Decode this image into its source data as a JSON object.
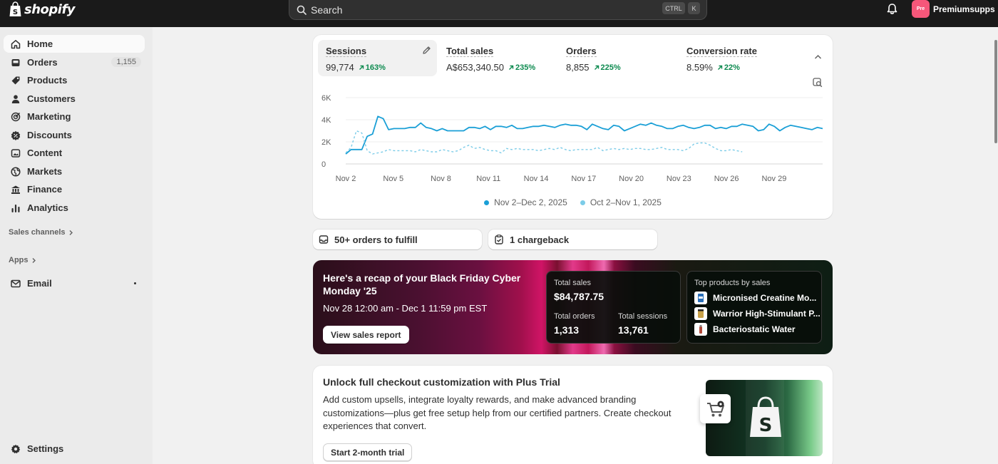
{
  "topbar": {
    "brand": "shopify",
    "search_placeholder": "Search",
    "shortcut_ctrl": "CTRL",
    "shortcut_k": "K",
    "store_initials": "Pre",
    "store_name": "Premiumsupps"
  },
  "sidebar": {
    "items": [
      {
        "label": "Home",
        "icon": "home-icon"
      },
      {
        "label": "Orders",
        "icon": "orders-icon",
        "badge": "1,155"
      },
      {
        "label": "Products",
        "icon": "tag-icon"
      },
      {
        "label": "Customers",
        "icon": "person-icon"
      },
      {
        "label": "Marketing",
        "icon": "target-icon"
      },
      {
        "label": "Discounts",
        "icon": "discount-icon"
      },
      {
        "label": "Content",
        "icon": "content-icon"
      },
      {
        "label": "Markets",
        "icon": "globe-icon"
      },
      {
        "label": "Finance",
        "icon": "bank-icon"
      },
      {
        "label": "Analytics",
        "icon": "bar-chart-icon"
      }
    ],
    "sales_channels_label": "Sales channels",
    "apps_label": "Apps",
    "email_label": "Email",
    "settings_label": "Settings"
  },
  "metrics": [
    {
      "label": "Sessions",
      "value": "99,774",
      "delta": "163%"
    },
    {
      "label": "Total sales",
      "value": "A$653,340.50",
      "delta": "235%"
    },
    {
      "label": "Orders",
      "value": "8,855",
      "delta": "225%"
    },
    {
      "label": "Conversion rate",
      "value": "8.59%",
      "delta": "22%"
    }
  ],
  "colors": {
    "current_series": "#1a9fd6",
    "previous_series": "#7ccce8",
    "positive_delta": "#0c8a4f"
  },
  "chart_data": {
    "type": "line",
    "title": "",
    "xlabel": "",
    "ylabel": "",
    "x_ticks": [
      "Nov 2",
      "Nov 5",
      "Nov 8",
      "Nov 11",
      "Nov 14",
      "Nov 17",
      "Nov 20",
      "Nov 23",
      "Nov 26",
      "Nov 29"
    ],
    "y_ticks": [
      "0",
      "2K",
      "4K",
      "6K"
    ],
    "ylim": [
      0,
      6000
    ],
    "grid": true,
    "series": [
      {
        "name": "Nov 2–Dec 2, 2025",
        "style": "solid",
        "values": [
          900,
          1300,
          1300,
          1300,
          2500,
          2700,
          4300,
          4100,
          3100,
          3200,
          3200,
          3200,
          3300,
          3300,
          3700,
          3300,
          3200,
          3000,
          3200,
          3000,
          3000,
          3000,
          3000,
          3300,
          3300,
          3200,
          3400,
          3100,
          3400,
          3400,
          3300,
          3500,
          3200,
          3200,
          3300,
          3400,
          3400,
          3500,
          3400,
          3300,
          3500,
          3600,
          3500,
          3500,
          3400,
          3100,
          3600,
          3400,
          3200,
          3100,
          3500,
          3400,
          3000,
          3200,
          3400,
          3600,
          3500,
          3700,
          3500,
          3400,
          3200,
          3200,
          3400,
          3500,
          3300,
          3200,
          3300,
          3500,
          3500,
          3200,
          3300,
          3200,
          3400,
          3400,
          3600,
          3500,
          3400,
          3000,
          3100,
          3600,
          3400,
          3000,
          3300,
          3500,
          3400,
          3300,
          3200,
          3100,
          3300,
          3200
        ]
      },
      {
        "name": "Oct 2–Nov 1, 2025",
        "style": "dashed",
        "values": [
          1000,
          1500,
          3000,
          2800,
          1200,
          900,
          1000,
          1100,
          1300,
          1200,
          1200,
          1200,
          1200,
          1100,
          1300,
          1200,
          1100,
          1100,
          1300,
          1200,
          1100,
          1200,
          1500,
          1700,
          1400,
          1500,
          1300,
          1200,
          1200,
          1000,
          1400,
          1300,
          1400,
          1300,
          1300,
          1300,
          1200,
          1300,
          1400,
          1300,
          1500,
          1300,
          1200,
          1300,
          1300,
          1300,
          1300,
          1500,
          1200,
          1300,
          1400,
          1300,
          1400,
          1300,
          1400,
          1400,
          1300,
          1300,
          1400,
          1500,
          1300,
          1300,
          1300,
          1200,
          1400,
          1800,
          1900,
          1900,
          1700,
          1400,
          1200,
          1200,
          1300,
          1200,
          1100
        ]
      }
    ]
  },
  "tasks": [
    {
      "label": "50+ orders to fulfill",
      "icon": "inbox-icon"
    },
    {
      "label": "1 chargeback",
      "icon": "clipboard-check-icon"
    }
  ],
  "bfcm": {
    "title": "Here's a recap of your Black Friday Cyber Monday '25",
    "date_range": "Nov 28 12:00 am - Dec 1 11:59 pm EST",
    "button": "View sales report",
    "total_sales_label": "Total sales",
    "total_sales": "$84,787.75",
    "total_orders_label": "Total orders",
    "total_orders": "1,313",
    "total_sessions_label": "Total sessions",
    "total_sessions": "13,761",
    "top_products_label": "Top products by sales",
    "top_products": [
      "Micronised Creatine Mo...",
      "Warrior High-Stimulant P...",
      "Bacteriostatic Water"
    ]
  },
  "plus_trial": {
    "title": "Unlock full checkout customization with Plus Trial",
    "description": "Add custom upsells, integrate loyalty rewards, and make advanced branding customizations—plus get free setup help from our certified partners. Create checkout experiences that convert.",
    "button": "Start 2-month trial"
  }
}
